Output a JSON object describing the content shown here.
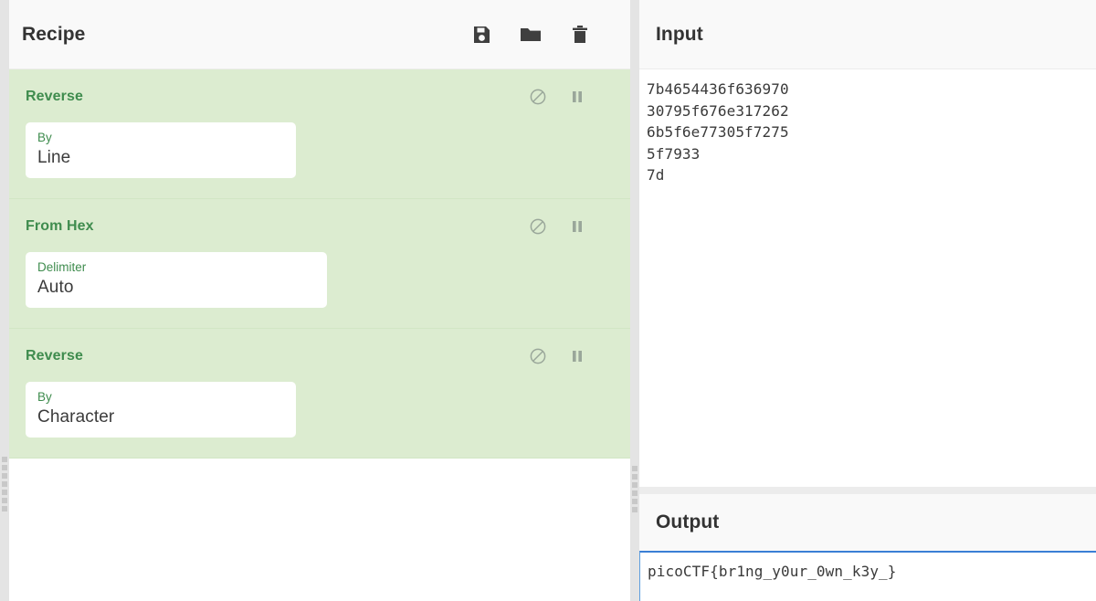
{
  "recipe": {
    "title": "Recipe",
    "toolbar": [
      {
        "name": "save-recipe-button",
        "icon": "save-icon"
      },
      {
        "name": "load-recipe-button",
        "icon": "folder-icon"
      },
      {
        "name": "clear-recipe-button",
        "icon": "trash-icon"
      }
    ],
    "operations": [
      {
        "name": "Reverse",
        "arg_label": "By",
        "arg_value": "Line",
        "disable_icon": "disable-icon",
        "breakpoint_icon": "pause-icon"
      },
      {
        "name": "From Hex",
        "arg_label": "Delimiter",
        "arg_value": "Auto",
        "disable_icon": "disable-icon",
        "breakpoint_icon": "pause-icon"
      },
      {
        "name": "Reverse",
        "arg_label": "By",
        "arg_value": "Character",
        "disable_icon": "disable-icon",
        "breakpoint_icon": "pause-icon"
      }
    ]
  },
  "input": {
    "title": "Input",
    "text": "7b4654436f636970\n30795f676e317262\n6b5f6e77305f7275\n5f7933\n7d"
  },
  "output": {
    "title": "Output",
    "text": "picoCTF{br1ng_y0ur_0wn_k3y_}"
  },
  "colors": {
    "operation_bg": "#dcecd0",
    "operation_label": "#3f8c4e",
    "panel_header_bg": "#f9f9f9",
    "output_focus_border": "#3a7fd5",
    "icon_gray": "#3f3f3f",
    "op_icon_gray": "#9aa79a"
  }
}
